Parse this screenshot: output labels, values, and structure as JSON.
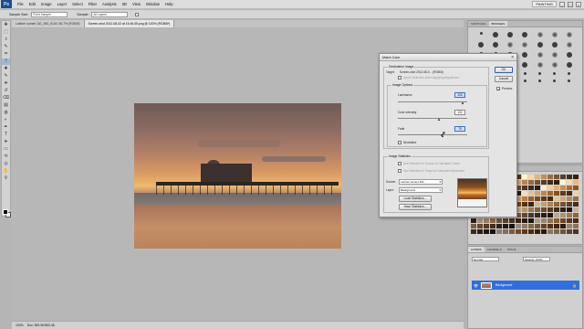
{
  "app": {
    "logo": "Ps",
    "menu": [
      "File",
      "Edit",
      "Image",
      "Layer",
      "Select",
      "Filter",
      "Analysis",
      "3D",
      "View",
      "Window",
      "Help"
    ],
    "workspace": "PAINTING",
    "window_controls": [
      "–",
      "□",
      "×"
    ]
  },
  "options": {
    "sample_size_label": "Sample Size:",
    "sample_size_value": "Point Sample",
    "sample_label": "Sample:",
    "sample_value": "All Layers"
  },
  "tabs": [
    {
      "label": "Latimer sunset 161_MG_6140, 66.7% (RGB/8)",
      "active": false
    },
    {
      "label": "Screen-shot 2012-08-02 at 15.46.05.png @ 100% (RGB/8*)",
      "active": true
    }
  ],
  "status": {
    "zoom": "100%",
    "doc": "Doc: 963.9K/963.4K"
  },
  "panels": {
    "top_tabs": [
      "SWATCHES",
      "BRUSHES"
    ],
    "swatch_tabs": [
      "NAVIGATOR",
      "HISTOGRAM"
    ],
    "layers_tabs": [
      "LAYERS",
      "CHANNELS",
      "PATHS"
    ],
    "blend_mode": "Normal",
    "opacity": "Opacity: 100%",
    "layer_name": "Background",
    "layer_lock": "🔒"
  },
  "dialog": {
    "title": "Match Color",
    "close": "×",
    "destination_label": "Destination Image",
    "target_label": "Target:",
    "target_value": "Screen-shot 2012-08-0... (RGB/8)",
    "ignore_selection": "Ignore Selection when Applying Adjustment",
    "image_options_label": "Image Options",
    "luminance_label": "Luminance",
    "luminance_value": "100",
    "color_intensity_label": "Color Intensity",
    "color_intensity_value": "132",
    "fade_label": "Fade",
    "fade_value": "75",
    "neutralize_label": "Neutralize",
    "image_statistics_label": "Image Statistics",
    "use_selection_source": "Use Selection in Source to Calculate Colors",
    "use_selection_target": "Use Selection in Target to Calculate Adjustment",
    "source_label": "Source:",
    "source_value": "Latimer sunset 161...",
    "layer_label": "Layer:",
    "layer_value": "Background",
    "load_statistics": "Load Statistics...",
    "save_statistics": "Save Statistics...",
    "ok": "OK",
    "cancel": "Cancel",
    "preview_label": "Preview",
    "preview_checked": true,
    "check_mark": "✓"
  },
  "colors": {
    "selection_blue": "#2f6fdc",
    "chrome": "#d0d0d0"
  },
  "icons": {
    "tools": [
      "move",
      "marquee",
      "lasso",
      "quick-select",
      "crop",
      "eyedropper",
      "heal",
      "brush",
      "stamp",
      "history-brush",
      "eraser",
      "gradient",
      "blur",
      "dodge",
      "pen",
      "type",
      "path-select",
      "shape",
      "3d-rotate",
      "3d-orbit",
      "hand",
      "zoom"
    ],
    "tool_glyphs": [
      "✥",
      "⬚",
      "ℓ",
      "✎",
      "⌗",
      "ℐ",
      "✚",
      "✎",
      "⎈",
      "↺",
      "⌫",
      "▤",
      "◍",
      "◐",
      "✒",
      "T",
      "➤",
      "▭",
      "⟲",
      "◎",
      "✋",
      "⚲"
    ],
    "eye_glyph": "👁",
    "cursor_glyph": "➚"
  }
}
